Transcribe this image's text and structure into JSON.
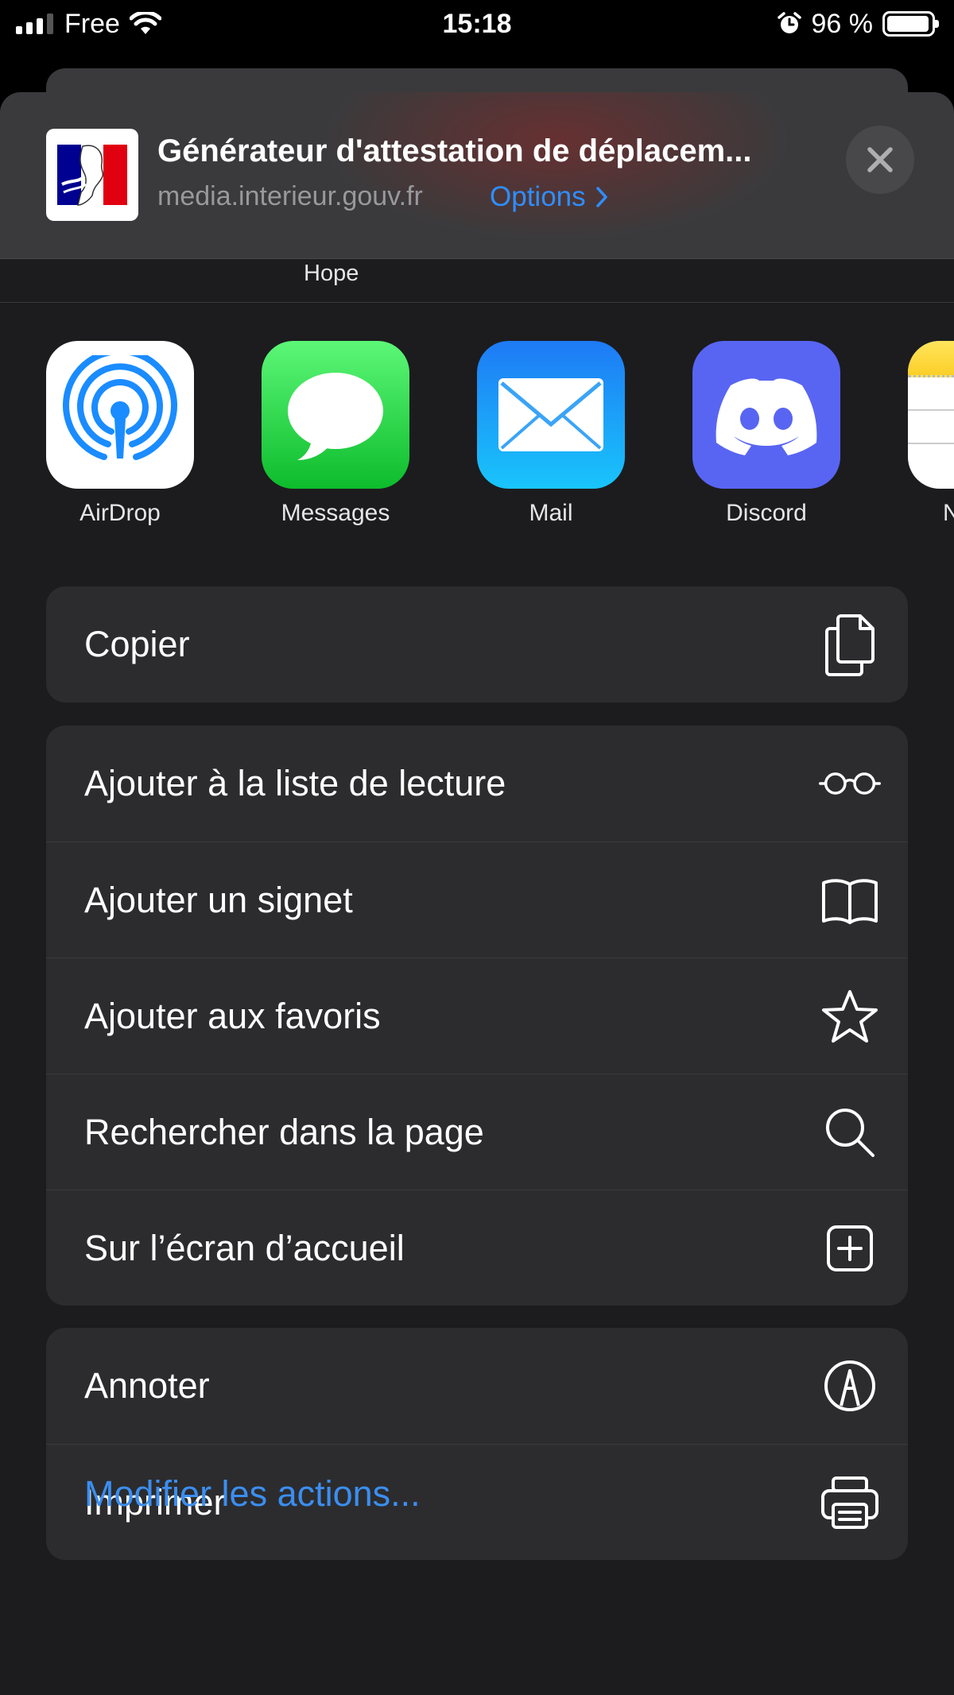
{
  "status_bar": {
    "carrier": "Free",
    "time": "15:18",
    "battery_percent": "96 %",
    "battery_level": 0.96
  },
  "share_header": {
    "title": "Générateur d'attestation de déplacem...",
    "url": "media.interieur.gouv.fr",
    "options_label": "Options"
  },
  "partial_contact": "Hope",
  "apps": [
    {
      "label": "AirDrop",
      "icon": "airdrop-icon"
    },
    {
      "label": "Messages",
      "icon": "messages-icon"
    },
    {
      "label": "Mail",
      "icon": "mail-icon"
    },
    {
      "label": "Discord",
      "icon": "discord-icon"
    },
    {
      "label": "N",
      "icon": "notes-icon"
    }
  ],
  "actions": {
    "group1": [
      {
        "label": "Copier",
        "icon": "copy-icon"
      }
    ],
    "group2": [
      {
        "label": "Ajouter à la liste de lecture",
        "icon": "glasses-icon"
      },
      {
        "label": "Ajouter un signet",
        "icon": "book-icon"
      },
      {
        "label": "Ajouter aux favoris",
        "icon": "star-icon"
      },
      {
        "label": "Rechercher dans la page",
        "icon": "search-icon"
      },
      {
        "label": "Sur l’écran d’accueil",
        "icon": "add-square-icon"
      }
    ],
    "group3": [
      {
        "label": "Annoter",
        "icon": "markup-icon"
      },
      {
        "label": "Imprimer",
        "icon": "printer-icon"
      }
    ]
  },
  "modify_actions_label": "Modifier les actions...",
  "colors": {
    "accent": "#2f8eff",
    "sheet_background": "#1c1c1e",
    "row_background": "#2c2c2e"
  }
}
